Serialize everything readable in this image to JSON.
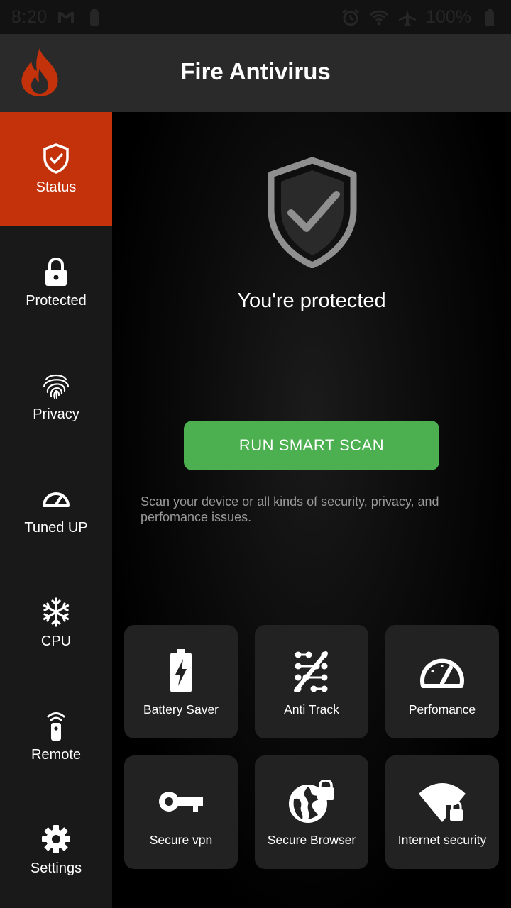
{
  "status_bar": {
    "time": "8:20",
    "battery_percent": "100%",
    "icons": [
      "gmail-icon",
      "battery-small-icon",
      "alarm-icon",
      "wifi-icon",
      "airplane-icon",
      "battery-icon"
    ]
  },
  "header": {
    "title": "Fire Antivirus",
    "logo_icon": "flame-icon"
  },
  "sidebar": {
    "items": [
      {
        "label": "Status",
        "icon": "shield-check-icon",
        "active": true
      },
      {
        "label": "Protected",
        "icon": "lock-icon",
        "active": false
      },
      {
        "label": "Privacy",
        "icon": "fingerprint-icon",
        "active": false
      },
      {
        "label": "Tuned UP",
        "icon": "speedometer-icon",
        "active": false
      },
      {
        "label": "CPU",
        "icon": "snowflake-icon",
        "active": false
      },
      {
        "label": "Remote",
        "icon": "remote-icon",
        "active": false
      },
      {
        "label": "Settings",
        "icon": "gear-icon",
        "active": false
      }
    ]
  },
  "main": {
    "status_text": "You're protected",
    "scan_button": "RUN SMART SCAN",
    "scan_description": "Scan your device or all kinds of security, privacy, and perfomance issues.",
    "tiles": [
      {
        "label": "Battery Saver",
        "icon": "battery-bolt-icon"
      },
      {
        "label": "Anti Track",
        "icon": "anti-track-icon"
      },
      {
        "label": "Perfomance",
        "icon": "gauge-icon"
      },
      {
        "label": "Secure vpn",
        "icon": "key-icon"
      },
      {
        "label": "Secure Browser",
        "icon": "globe-lock-icon"
      },
      {
        "label": "Internet security",
        "icon": "wifi-lock-icon"
      }
    ]
  },
  "colors": {
    "accent": "#c3320a",
    "scan_button": "#4caf50",
    "sidebar_bg": "#191919",
    "header_bg": "#2a2a2a",
    "tile_bg": "#222222"
  }
}
